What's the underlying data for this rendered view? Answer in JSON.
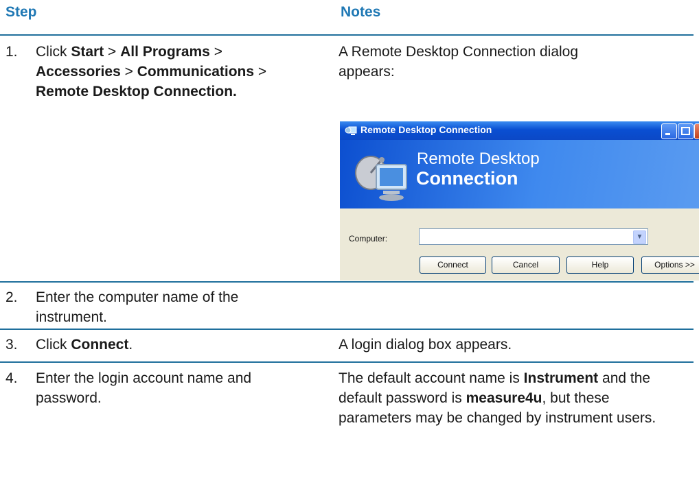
{
  "headers": {
    "step": "Step",
    "notes": "Notes"
  },
  "rows": [
    {
      "num": "1.",
      "step_parts": [
        "Click ",
        "Start",
        " > ",
        "All Programs",
        " > ",
        "Accessories",
        " > ",
        "Communications",
        " > ",
        "Remote Desktop Connection."
      ],
      "note_line": "A Remote Desktop Connection dialog appears:"
    },
    {
      "num": "2.",
      "step": "Enter the computer name of the instrument."
    },
    {
      "num": "3.",
      "step_parts": [
        "Click ",
        "Connect",
        "."
      ],
      "note": "A login dialog box appears."
    },
    {
      "num": "4.",
      "step": "Enter the login account name and password.",
      "note_parts": [
        "The default account name is ",
        "Instrument",
        " and the default password is ",
        "measure4u",
        ", but these parameters may be changed by instrument users."
      ]
    }
  ],
  "dialog": {
    "title": "Remote Desktop Connection",
    "banner_line1": "Remote Desktop",
    "banner_line2": "Connection",
    "computer_label": "Computer:",
    "computer_value": "",
    "buttons": {
      "connect": "Connect",
      "cancel": "Cancel",
      "help": "Help",
      "options": "Options >>"
    }
  },
  "colors": {
    "header": "#1f78b4",
    "rule": "#1f6f9c",
    "xp_title": "#0a4fd2"
  }
}
